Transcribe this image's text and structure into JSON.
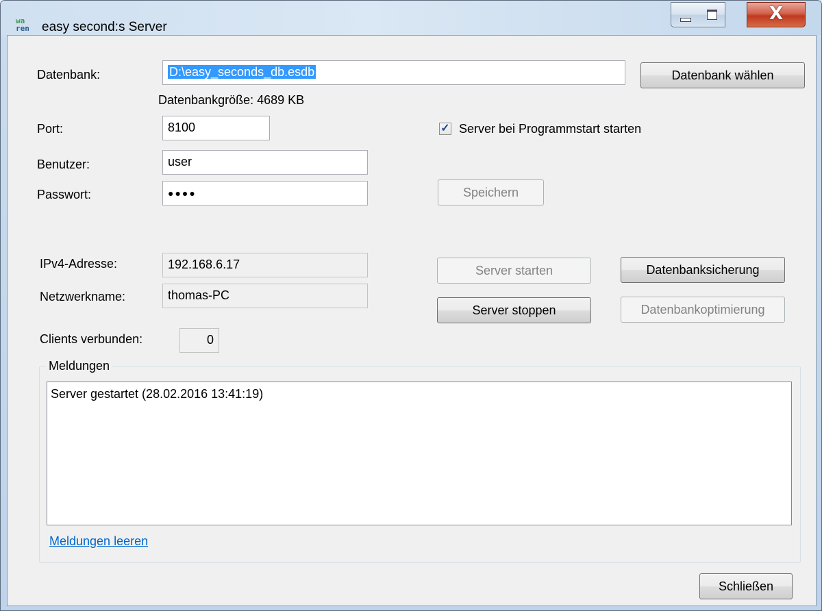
{
  "window": {
    "title": "easy second:s Server",
    "icon": "wa-ren-app-icon",
    "icon_text_line1": "wa",
    "icon_text_line2": "ren",
    "buttons": {
      "minimize": "minimize-icon",
      "maximize": "maximize-icon",
      "close": "close-icon",
      "close_glyph": "X"
    }
  },
  "database": {
    "label": "Datenbank:",
    "path": "D:\\easy_seconds_db.esdb",
    "choose_button": "Datenbank wählen",
    "size_text": "Datenbankgröße: 4689 KB"
  },
  "settings": {
    "port_label": "Port:",
    "port_value": "8100",
    "user_label": "Benutzer:",
    "user_value": "user",
    "password_label": "Passwort:",
    "password_value": "●●●●",
    "autostart_label": "Server bei Programmstart starten",
    "autostart_checked": true,
    "check_glyph": "✓",
    "save_button": "Speichern"
  },
  "network": {
    "ip_label": "IPv4-Adresse:",
    "ip_value": "192.168.6.17",
    "name_label": "Netzwerkname:",
    "name_value": "thomas-PC",
    "clients_label": "Clients verbunden:",
    "clients_value": "0"
  },
  "actions": {
    "start": "Server starten",
    "stop": "Server stoppen",
    "backup": "Datenbanksicherung",
    "optimize": "Datenbankoptimierung"
  },
  "messages": {
    "group_title": "Meldungen",
    "lines": [
      "Server gestartet (28.02.2016 13:41:19)"
    ],
    "clear_link": "Meldungen leeren"
  },
  "footer": {
    "close_button": "Schließen"
  },
  "colors": {
    "selection": "#3399ff",
    "link": "#0066cc",
    "close_button": "#c0391f"
  }
}
